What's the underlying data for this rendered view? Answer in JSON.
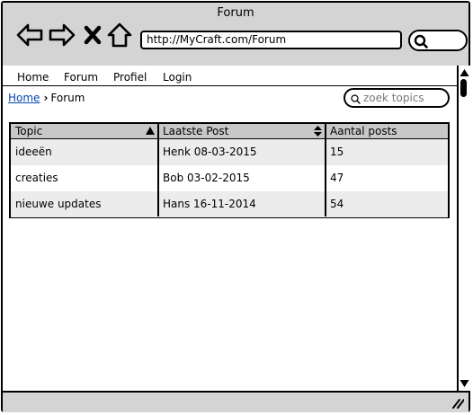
{
  "window": {
    "title": "Forum"
  },
  "toolbar": {
    "icons": [
      "back-arrow-icon",
      "forward-arrow-icon",
      "close-x-icon",
      "home-icon",
      "search-icon"
    ],
    "url": "http://MyCraft.com/Forum"
  },
  "menu": {
    "items": [
      {
        "label": "Home"
      },
      {
        "label": "Forum"
      },
      {
        "label": "Profiel"
      },
      {
        "label": "Login"
      }
    ]
  },
  "breadcrumb": {
    "home": "Home",
    "current": "Forum"
  },
  "search": {
    "placeholder": "zoek topics"
  },
  "table": {
    "columns": [
      {
        "label": "Topic",
        "sort": "ascending"
      },
      {
        "label": "Laatste Post",
        "sort": "sortable"
      },
      {
        "label": "Aantal posts",
        "sort": "none"
      }
    ],
    "rows": [
      {
        "topic": "ideeën",
        "last_post": "Henk 08-03-2015",
        "count": "15"
      },
      {
        "topic": "creaties",
        "last_post": "Bob 03-02-2015",
        "count": "47"
      },
      {
        "topic": "nieuwe updates",
        "last_post": "Hans 16-11-2014",
        "count": "54"
      }
    ]
  },
  "colors": {
    "chrome": "#d4d4d4",
    "table_header": "#c8c8c8",
    "row_alt": "#ececec",
    "link": "#0645ad"
  }
}
